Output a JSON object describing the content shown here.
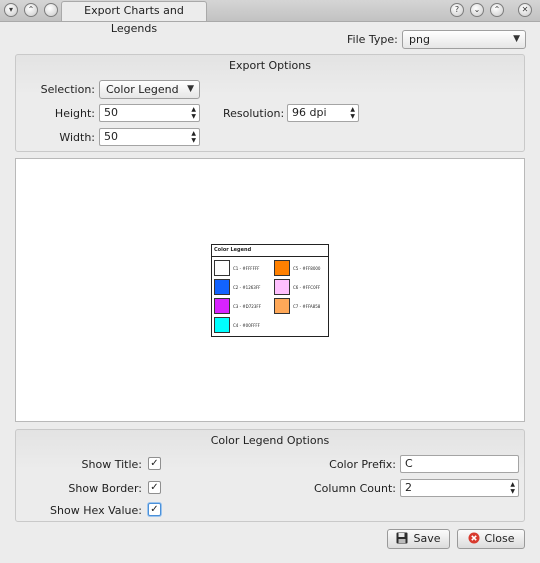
{
  "window": {
    "title": "Export Charts and Legends"
  },
  "file_type": {
    "label": "File Type:",
    "value": "png"
  },
  "export_options": {
    "title": "Export Options",
    "selection_label": "Selection:",
    "selection_value": "Color Legend",
    "height_label": "Height:",
    "height_value": "50",
    "resolution_label": "Resolution:",
    "resolution_value": "96 dpi",
    "width_label": "Width:",
    "width_value": "50"
  },
  "legend_preview": {
    "title": "Color Legend",
    "items": [
      {
        "label": "C1 - #FFFFFF",
        "color": "#FFFFFF"
      },
      {
        "label": "C2 - #1263FF",
        "color": "#1263FF"
      },
      {
        "label": "C3 - #D723FF",
        "color": "#D723FF"
      },
      {
        "label": "C4 - #00FFFF",
        "color": "#00FFFF"
      },
      {
        "label": "C5 - #FF8000",
        "color": "#FF8000"
      },
      {
        "label": "C6 - #FFC0FF",
        "color": "#FFC0FF"
      },
      {
        "label": "C7 - #FFA858",
        "color": "#FFA858"
      }
    ]
  },
  "color_legend_options": {
    "title": "Color Legend Options",
    "show_title_label": "Show Title:",
    "show_title_checked": true,
    "show_border_label": "Show Border:",
    "show_border_checked": true,
    "show_hex_label": "Show Hex Value:",
    "show_hex_checked": true,
    "color_prefix_label": "Color Prefix:",
    "color_prefix_value": "C",
    "column_count_label": "Column Count:",
    "column_count_value": "2"
  },
  "buttons": {
    "save": "Save",
    "close": "Close"
  }
}
